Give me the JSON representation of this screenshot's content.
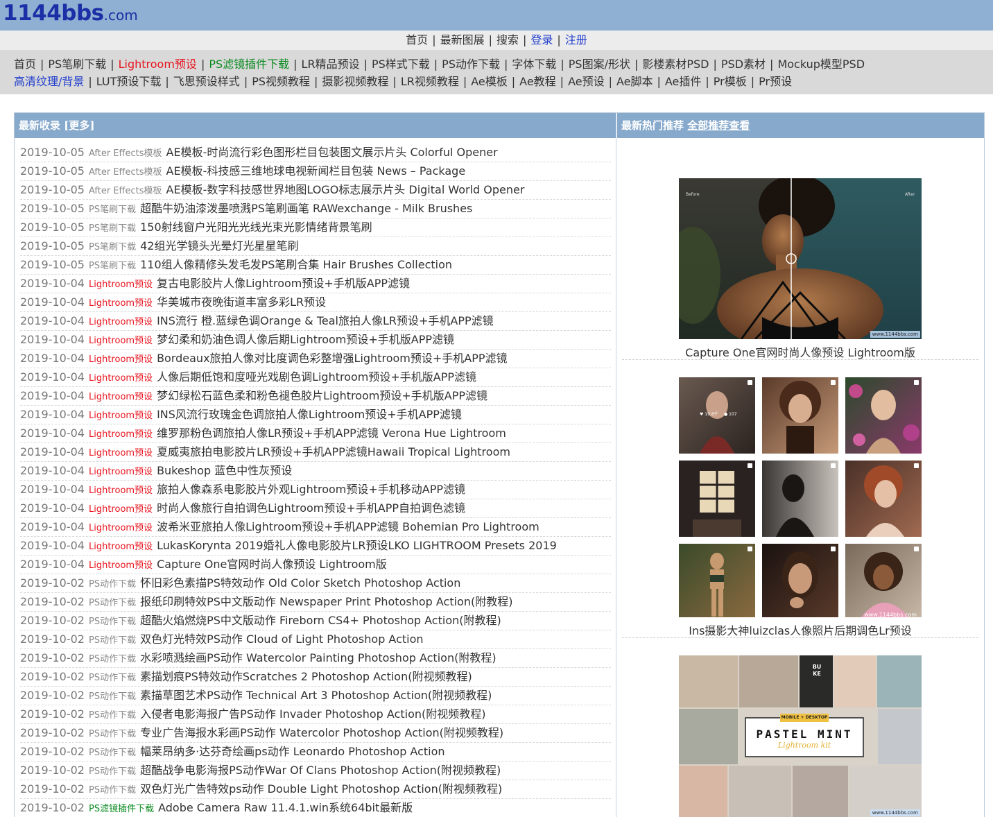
{
  "site": {
    "logo_main": "1144bbs",
    "logo_suffix": ".com"
  },
  "top_nav": {
    "items": [
      {
        "label": "首页",
        "color": "#333333"
      },
      {
        "label": "最新图展",
        "color": "#333333"
      },
      {
        "label": "搜索",
        "color": "#333333"
      },
      {
        "label": "登录",
        "color": "#1f3ccc"
      },
      {
        "label": "注册",
        "color": "#1f3ccc"
      }
    ]
  },
  "category_nav": {
    "row1": [
      {
        "label": "首页",
        "color": "default"
      },
      {
        "label": "PS笔刷下载",
        "color": "default"
      },
      {
        "label": "Lightroom预设",
        "color": "red"
      },
      {
        "label": "PS滤镜插件下载",
        "color": "green"
      },
      {
        "label": "LR精品预设",
        "color": "default"
      },
      {
        "label": "PS样式下载",
        "color": "default"
      },
      {
        "label": "PS动作下载",
        "color": "default"
      },
      {
        "label": "字体下载",
        "color": "default"
      },
      {
        "label": "PS图案/形状",
        "color": "default"
      },
      {
        "label": "影楼素材PSD",
        "color": "default"
      },
      {
        "label": "PSD素材",
        "color": "default"
      },
      {
        "label": "Mockup模型PSD",
        "color": "default"
      }
    ],
    "row2": [
      {
        "label": "高清纹理/背景",
        "color": "blue"
      },
      {
        "label": "LUT预设下载",
        "color": "default"
      },
      {
        "label": "飞思预设样式",
        "color": "default"
      },
      {
        "label": "PS视频教程",
        "color": "default"
      },
      {
        "label": "摄影视频教程",
        "color": "default"
      },
      {
        "label": "LR视频教程",
        "color": "default"
      },
      {
        "label": "Ae模板",
        "color": "default"
      },
      {
        "label": "Ae教程",
        "color": "default"
      },
      {
        "label": "Ae预设",
        "color": "default"
      },
      {
        "label": "Ae脚本",
        "color": "default"
      },
      {
        "label": "Ae插件",
        "color": "default"
      },
      {
        "label": "Pr模板",
        "color": "default"
      },
      {
        "label": "Pr预设",
        "color": "default"
      }
    ]
  },
  "latest": {
    "header": "最新收录",
    "more_label": "[更多]",
    "items": [
      {
        "date": "2019-10-05",
        "category": "After Effects模板",
        "cat_color": "gray",
        "title": "AE模板-时尚流行彩色图形栏目包装图文展示片头 Colorful Opener"
      },
      {
        "date": "2019-10-05",
        "category": "After Effects模板",
        "cat_color": "gray",
        "title": "AE模板-科技感三维地球电视新闻栏目包装 News – Package"
      },
      {
        "date": "2019-10-05",
        "category": "After Effects模板",
        "cat_color": "gray",
        "title": "AE模板-数字科技感世界地图LOGO标志展示片头 Digital World Opener"
      },
      {
        "date": "2019-10-05",
        "category": "PS笔刷下载",
        "cat_color": "gray",
        "title": "超酷牛奶油漆泼墨喷溅PS笔刷画笔 RAWexchange - Milk Brushes"
      },
      {
        "date": "2019-10-05",
        "category": "PS笔刷下载",
        "cat_color": "gray",
        "title": "150射线窗户光阳光光线光束光影情绪背景笔刷"
      },
      {
        "date": "2019-10-05",
        "category": "PS笔刷下载",
        "cat_color": "gray",
        "title": "42组光学镜头光晕灯光星星笔刷"
      },
      {
        "date": "2019-10-05",
        "category": "PS笔刷下载",
        "cat_color": "gray",
        "title": "110组人像精修头发毛发PS笔刷合集 Hair Brushes Collection"
      },
      {
        "date": "2019-10-04",
        "category": "Lightroom预设",
        "cat_color": "red",
        "title": "复古电影胶片人像Lightroom预设+手机版APP滤镜"
      },
      {
        "date": "2019-10-04",
        "category": "Lightroom预设",
        "cat_color": "red",
        "title": "华美城市夜晚街道丰富多彩LR预设"
      },
      {
        "date": "2019-10-04",
        "category": "Lightroom预设",
        "cat_color": "red",
        "title": "INS流行 橙.蓝绿色调Orange & Teal旅拍人像LR预设+手机APP滤镜"
      },
      {
        "date": "2019-10-04",
        "category": "Lightroom预设",
        "cat_color": "red",
        "title": "梦幻柔和奶油色调人像后期Lightroom预设+手机版APP滤镜"
      },
      {
        "date": "2019-10-04",
        "category": "Lightroom预设",
        "cat_color": "red",
        "title": "Bordeaux旅拍人像对比度调色彩整增强Lightroom预设+手机APP滤镜"
      },
      {
        "date": "2019-10-04",
        "category": "Lightroom预设",
        "cat_color": "red",
        "title": "人像后期低饱和度哑光戏剧色调Lightroom预设+手机版APP滤镜"
      },
      {
        "date": "2019-10-04",
        "category": "Lightroom预设",
        "cat_color": "red",
        "title": "梦幻绿松石蓝色柔和粉色褪色胶片Lightroom预设+手机版APP滤镜"
      },
      {
        "date": "2019-10-04",
        "category": "Lightroom预设",
        "cat_color": "red",
        "title": "INS风流行玫瑰金色调旅拍人像Lightroom预设+手机APP滤镜"
      },
      {
        "date": "2019-10-04",
        "category": "Lightroom预设",
        "cat_color": "red",
        "title": "维罗那粉色调旅拍人像LR预设+手机APP滤镜 Verona Hue Lightroom"
      },
      {
        "date": "2019-10-04",
        "category": "Lightroom预设",
        "cat_color": "red",
        "title": "夏威夷旅拍电影胶片LR预设+手机APP滤镜Hawaii Tropical Lightroom"
      },
      {
        "date": "2019-10-04",
        "category": "Lightroom预设",
        "cat_color": "red",
        "title": "Bukeshop 蓝色中性灰预设"
      },
      {
        "date": "2019-10-04",
        "category": "Lightroom预设",
        "cat_color": "red",
        "title": "旅拍人像森系电影胶片外观Lightroom预设+手机移动APP滤镜"
      },
      {
        "date": "2019-10-04",
        "category": "Lightroom预设",
        "cat_color": "red",
        "title": "时尚人像旅行自拍调色Lightroom预设+手机APP自拍调色滤镜"
      },
      {
        "date": "2019-10-04",
        "category": "Lightroom预设",
        "cat_color": "red",
        "title": "波希米亚旅拍人像Lightroom预设+手机APP滤镜 Bohemian Pro Lightroom"
      },
      {
        "date": "2019-10-04",
        "category": "Lightroom预设",
        "cat_color": "red",
        "title": "LukasKorynta 2019婚礼人像电影胶片LR预设LKO LIGHTROOM Presets 2019"
      },
      {
        "date": "2019-10-04",
        "category": "Lightroom预设",
        "cat_color": "red",
        "title": "Capture One官网时尚人像预设 Lightroom版"
      },
      {
        "date": "2019-10-02",
        "category": "PS动作下载",
        "cat_color": "gray",
        "title": "怀旧彩色素描PS特效动作 Old Color Sketch Photoshop Action"
      },
      {
        "date": "2019-10-02",
        "category": "PS动作下载",
        "cat_color": "gray",
        "title": "报纸印刷特效PS中文版动作 Newspaper Print Photoshop Action(附教程)"
      },
      {
        "date": "2019-10-02",
        "category": "PS动作下载",
        "cat_color": "gray",
        "title": "超酷火焰燃烧PS中文版动作 Fireborn CS4+ Photoshop Action(附教程)"
      },
      {
        "date": "2019-10-02",
        "category": "PS动作下载",
        "cat_color": "gray",
        "title": "双色灯光特效PS动作 Cloud of Light Photoshop Action"
      },
      {
        "date": "2019-10-02",
        "category": "PS动作下载",
        "cat_color": "gray",
        "title": "水彩喷溅绘画PS动作 Watercolor Painting Photoshop Action(附教程)"
      },
      {
        "date": "2019-10-02",
        "category": "PS动作下载",
        "cat_color": "gray",
        "title": "素描划痕PS特效动作Scratches 2 Photoshop Action(附视频教程)"
      },
      {
        "date": "2019-10-02",
        "category": "PS动作下载",
        "cat_color": "gray",
        "title": "素描草图艺术PS动作 Technical Art 3 Photoshop Action(附视频教程)"
      },
      {
        "date": "2019-10-02",
        "category": "PS动作下载",
        "cat_color": "gray",
        "title": "入侵者电影海报广告PS动作 Invader Photoshop Action(附视频教程)"
      },
      {
        "date": "2019-10-02",
        "category": "PS动作下载",
        "cat_color": "gray",
        "title": "专业广告海报水彩画PS动作 Watercolor Photoshop Action(附视频教程)"
      },
      {
        "date": "2019-10-02",
        "category": "PS动作下载",
        "cat_color": "gray",
        "title": "幅莱昂纳多·达芬奇绘画ps动作 Leonardo Photoshop Action"
      },
      {
        "date": "2019-10-02",
        "category": "PS动作下载",
        "cat_color": "gray",
        "title": "超酷战争电影海报PS动作War Of Clans Photoshop Action(附视频教程)"
      },
      {
        "date": "2019-10-02",
        "category": "PS动作下载",
        "cat_color": "gray",
        "title": "双色灯光广告特效ps动作 Double Light Photoshop Action(附视频教程)"
      },
      {
        "date": "2019-10-02",
        "category": "PS滤镜插件下载",
        "cat_color": "green",
        "title": "Adobe Camera Raw 11.4.1.win系统64bit最新版"
      }
    ]
  },
  "hot": {
    "header": "最新热门推荐",
    "all_label": "全部推荐查看",
    "recs": [
      {
        "caption": "Capture One官网时尚人像预设 Lightroom版",
        "before_label": "Before",
        "after_label": "After",
        "watermark": "www.1144bbs.com"
      },
      {
        "caption": "Ins摄影大神luizclas人像照片后期调色Lr预设",
        "watermark": "www.1144bbs.com"
      },
      {
        "caption": "",
        "badge_top": "MOBILE + DESKTOP",
        "badge_main": "PASTEL MINT",
        "badge_sub": "Lightroom kit",
        "buke": "BU KE",
        "watermark": "www.1144bbs.com"
      }
    ]
  }
}
